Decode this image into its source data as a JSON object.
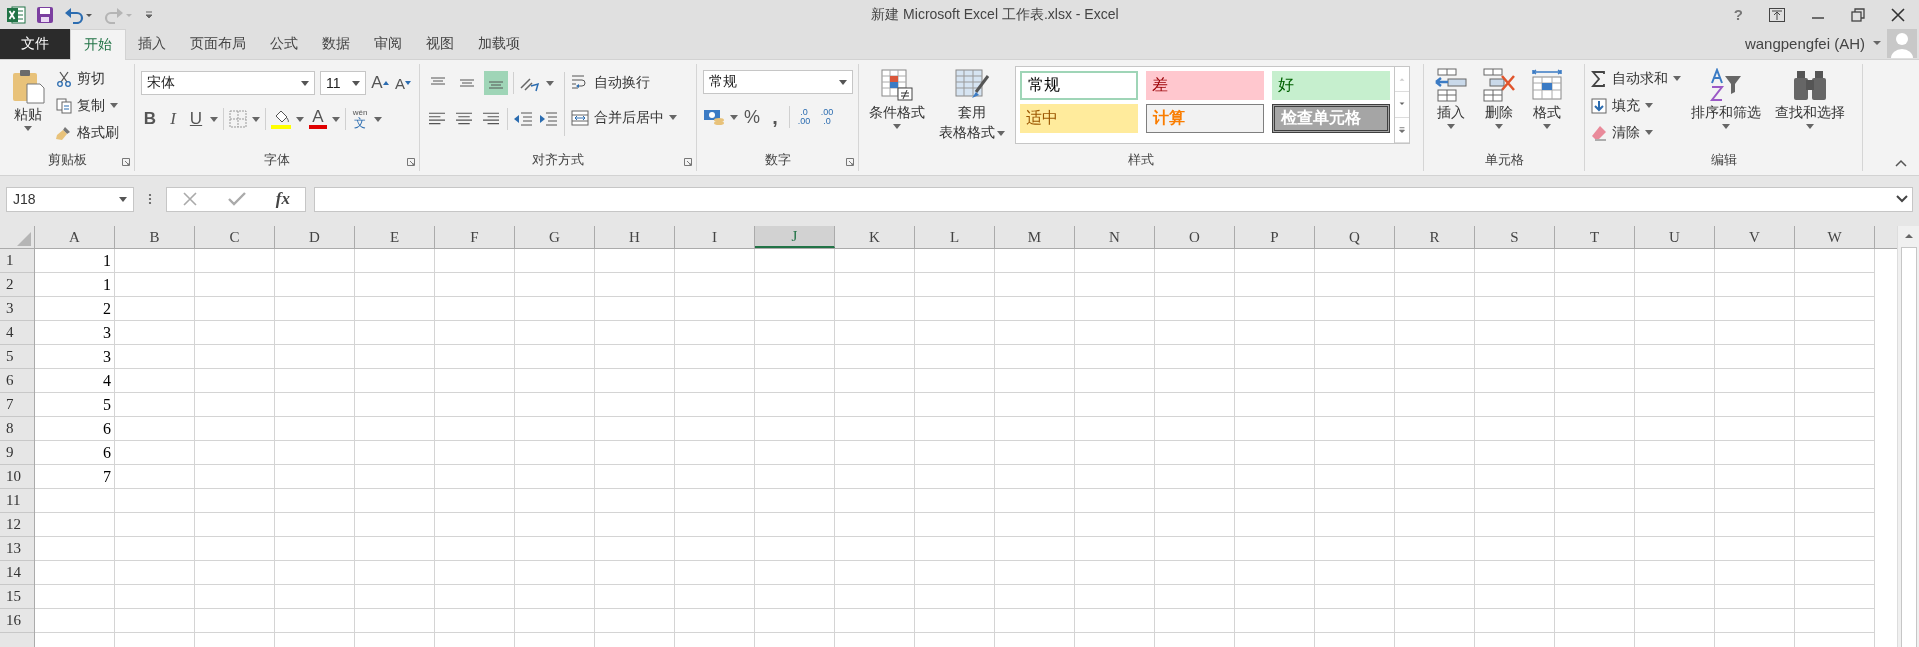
{
  "window": {
    "title": "新建 Microsoft Excel 工作表.xlsx - Excel",
    "help": "?"
  },
  "account": {
    "user": "wangpengfei (AH)"
  },
  "tabs": [
    {
      "label": "文件",
      "kind": "file",
      "selected": false
    },
    {
      "label": "开始",
      "kind": "tab",
      "selected": true
    },
    {
      "label": "插入",
      "kind": "tab",
      "selected": false
    },
    {
      "label": "页面布局",
      "kind": "tab",
      "selected": false
    },
    {
      "label": "公式",
      "kind": "tab",
      "selected": false
    },
    {
      "label": "数据",
      "kind": "tab",
      "selected": false
    },
    {
      "label": "审阅",
      "kind": "tab",
      "selected": false
    },
    {
      "label": "视图",
      "kind": "tab",
      "selected": false
    },
    {
      "label": "加载项",
      "kind": "tab",
      "selected": false
    }
  ],
  "clipboard": {
    "title": "剪贴板",
    "paste": "粘贴",
    "cut": "剪切",
    "copy": "复制",
    "painter": "格式刷"
  },
  "font": {
    "title": "字体",
    "name": "宋体",
    "size": "11",
    "grow": "A",
    "shrink": "A",
    "bold": "B",
    "italic": "I",
    "underline": "U",
    "color_button": "A",
    "phonetic_top": "wén",
    "phonetic_bottom": "文"
  },
  "alignment": {
    "title": "对齐方式",
    "vertical": [
      {
        "selected": false
      },
      {
        "selected": false
      },
      {
        "selected": true
      }
    ],
    "wrap": "自动换行",
    "merge": "合并后居中"
  },
  "number": {
    "title": "数字",
    "format": "常规",
    "percent": "%",
    "comma": ",",
    "increase_decimal": [
      ".0",
      ".00"
    ],
    "decrease_decimal": [
      ".00",
      ".0"
    ]
  },
  "styles": {
    "title": "样式",
    "conditional": "条件格式",
    "table": [
      "套用",
      "表格格式"
    ],
    "gallery": [
      {
        "label": "常规",
        "kind": "normal",
        "selected": true
      },
      {
        "label": "差",
        "kind": "bad",
        "selected": false
      },
      {
        "label": "好",
        "kind": "good",
        "selected": false
      },
      {
        "label": "适中",
        "kind": "neutral",
        "selected": false
      },
      {
        "label": "计算",
        "kind": "calculation",
        "selected": false
      },
      {
        "label": "检查单元格",
        "kind": "check",
        "selected": false
      }
    ]
  },
  "cells": {
    "title": "单元格",
    "buttons": [
      "插入",
      "删除",
      "格式"
    ]
  },
  "editing": {
    "title": "编辑",
    "autosum": "自动求和",
    "fill": "填充",
    "clear": "清除",
    "sort": "排序和筛选",
    "find": "查找和选择"
  },
  "formula_bar": {
    "name_box": "J18",
    "fx": "fx"
  },
  "sheet": {
    "columns": [
      {
        "label": "A",
        "selected": false
      },
      {
        "label": "B",
        "selected": false
      },
      {
        "label": "C",
        "selected": false
      },
      {
        "label": "D",
        "selected": false
      },
      {
        "label": "E",
        "selected": false
      },
      {
        "label": "F",
        "selected": false
      },
      {
        "label": "G",
        "selected": false
      },
      {
        "label": "H",
        "selected": false
      },
      {
        "label": "I",
        "selected": false
      },
      {
        "label": "J",
        "selected": true
      },
      {
        "label": "K",
        "selected": false
      },
      {
        "label": "L",
        "selected": false
      },
      {
        "label": "M",
        "selected": false
      },
      {
        "label": "N",
        "selected": false
      },
      {
        "label": "O",
        "selected": false
      },
      {
        "label": "P",
        "selected": false
      },
      {
        "label": "Q",
        "selected": false
      },
      {
        "label": "R",
        "selected": false
      },
      {
        "label": "S",
        "selected": false
      },
      {
        "label": "T",
        "selected": false
      },
      {
        "label": "U",
        "selected": false
      },
      {
        "label": "V",
        "selected": false
      },
      {
        "label": "W",
        "selected": false
      }
    ],
    "rows": [
      {
        "label": "1",
        "a": "1"
      },
      {
        "label": "2",
        "a": "1"
      },
      {
        "label": "3",
        "a": "2"
      },
      {
        "label": "4",
        "a": "3"
      },
      {
        "label": "5",
        "a": "3"
      },
      {
        "label": "6",
        "a": "4"
      },
      {
        "label": "7",
        "a": "5"
      },
      {
        "label": "8",
        "a": "6"
      },
      {
        "label": "9",
        "a": "6"
      },
      {
        "label": "10",
        "a": "7"
      },
      {
        "label": "11"
      },
      {
        "label": "12"
      },
      {
        "label": "13"
      },
      {
        "label": "14"
      },
      {
        "label": "15"
      },
      {
        "label": "16"
      }
    ]
  }
}
